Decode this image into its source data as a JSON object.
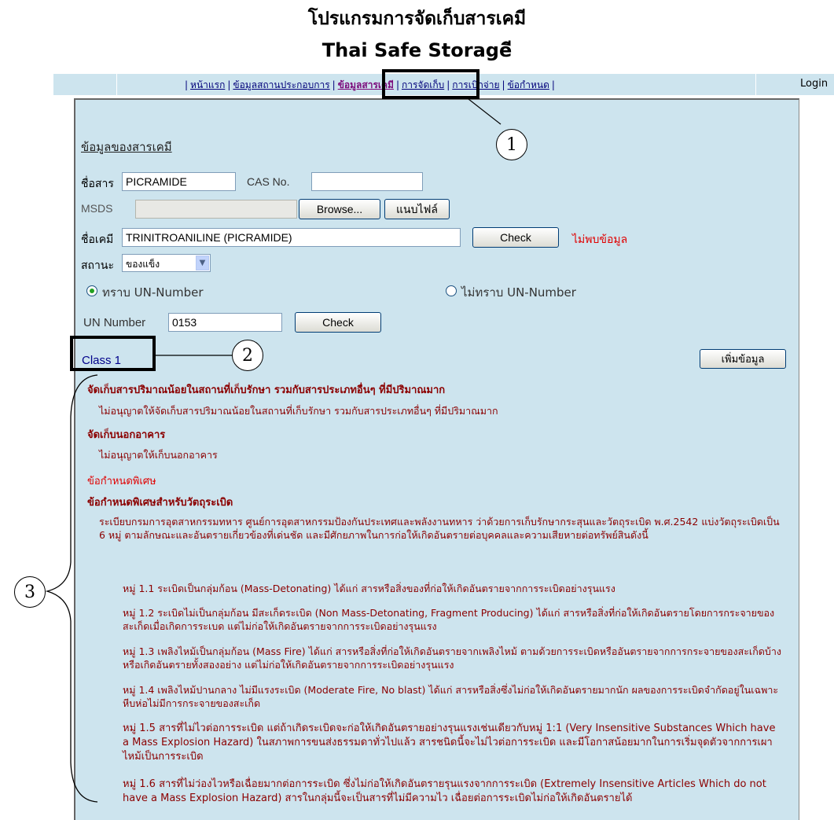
{
  "header": {
    "title_th": "โปรแกรมการจัดเก็บสารเคมี",
    "title_en": "Thai Safe Storageี"
  },
  "nav": {
    "links": [
      "หน้าแรก",
      "ข้อมูลสถานประกอบการ",
      "ข้อมูลสารเคมี",
      "การจัดเก็บ",
      "การเบิกจ่าย",
      "ข้อกำหนด"
    ],
    "active": "ข้อมูลสารเคมี",
    "separator": "|",
    "login": "Login"
  },
  "callouts": [
    "1",
    "2",
    "3"
  ],
  "form": {
    "section_title": "ข้อมูลของสารเคมี",
    "name_label": "ชื่อสาร",
    "name_value": "PICRAMIDE",
    "cas_label": "CAS No.",
    "cas_value": "",
    "msds_label": "MSDS",
    "browse_button": "Browse...",
    "attach_button": "แนบไฟล์",
    "chem_label": "ชื่อเคมี",
    "chem_value": "TRINITROANILINE (PICRAMIDE)",
    "check_button": "Check",
    "not_found": "ไม่พบข้อมูล",
    "state_label": "สถานะ",
    "state_value": "ของแข็ง",
    "radio_known": "ทราบ UN-Number",
    "radio_unknown": "ไม่ทราบ UN-Number",
    "un_label": "UN Number",
    "un_value": "0153",
    "un_check_button": "Check",
    "class_label": "Class 1",
    "add_button": "เพิ่มข้อมูล"
  },
  "details": {
    "h1": "จัดเก็บสารปริมาณน้อยในสถานที่เก็บรักษา รวมกับสารประเภทอื่นๆ ที่มีปริมาณมาก",
    "p1": "ไม่อนุญาตให้จัดเก็บสารปริมาณน้อยในสถานที่เก็บรักษา รวมกับสารประเภทอื่นๆ ที่มีปริมาณมาก",
    "h2": "จัดเก็บนอกอาคาร",
    "p2": "ไม่อนุญาตให้เก็บนอกอาคาร",
    "special": "ข้อกำหนดพิเศษ",
    "h3": "ข้อกำหนดพิเศษสำหรับวัตถุระเบิด",
    "p3": "ระเบียบกรมการอุตสาหกรรมทหาร ศูนย์การอุตสาหกรรมป้องกันประเทศและพลังงานทหาร ว่าด้วยการเก็บรักษากระสุนและวัตถุระเบิด พ.ศ.2542 แบ่งวัตถุระเบิดเป็น 6 หมู่ ตามลักษณะและอันตรายเกี่ยวข้องที่เด่นชัด และมีศักยภาพในการก่อให้เกิดอันตรายต่อบุคคลและความเสียหายต่อทรัพย์สินดังนี้",
    "groups": [
      "หมู่ 1.1 ระเบิดเป็นกลุ่มก้อน (Mass-Detonating) ได้แก่ สารหรือสิ่งของที่ก่อให้เกิดอันตรายจากการระเบิดอย่างรุนแรง",
      "หมู่ 1.2 ระเบิดไม่เป็นกลุ่มก้อน มีสะเก็ดระเบิด (Non Mass-Detonating, Fragment Producing) ได้แก่ สารหรือสิ่งที่ก่อให้เกิดอันตรายโดยการกระจายของสะเก็ดเมื่อเกิดการระเบด แต่ไม่ก่อให้เกิดอันตรายจากการระเบิดอย่างรุนแรง",
      "หมู่ 1.3 เพลิงไหม้เป็นกลุ่มก้อน (Mass Fire) ได้แก่ สารหรือสิ่งที่ก่อให้เกิดอันตรายจากเพลิงไหม้ ตามด้วยการระเบิดหรืออันตรายจากการกระจายของสะเก็ดบ้าง หรือเกิดอันตรายทั้งสองอย่าง แต่ไม่ก่อให้เกิดอันตรายจากการระเบิดอย่างรุนแรง",
      "หมู่ 1.4 เพลิงไหม้ปานกลาง ไม่มีแรงระเบิด (Moderate Fire, No blast) ได้แก่ สารหรือสิ่งซึ่งไม่ก่อให้เกิดอันตรายมากนัก ผลของการระเบิดจำกัดอยู่ในเฉพาะหีบห่อไม่มีการกระจายของสะเก็ด",
      "หมู่ 1.5 สารที่ไม่ไวต่อการระเบิด แต่ถ้าเกิดระเบิดจะก่อให้เกิดอันตรายอย่างรุนแรงเช่นเดียวกับหมู่ 1:1 (Very Insensitive Substances Which have a Mass Explosion Hazard) ในสภาพการขนส่งธรรมดาทั่วไปแล้ว สารชนิดนี้จะไม่ไวต่อการระเบิด และมีโอกาสน้อยมากในการเริ่มจุดตัวจากการเผาไหม้เป็นการระเบิด",
      "หมู่ 1.6 สารที่ไม่ว่องไวหรือเฉื่อยมากต่อการระเบิด ซึ่งไม่ก่อให้เกิดอันตรายรุนแรงจากการระเบิด (Extremely Insensitive Articles Which do not have a Mass Explosion Hazard) สารในกลุ่มนี้จะเป็นสารที่ไม่มีความไว เฉื่อยต่อการระเบิดไม่ก่อให้เกิดอันตรายได้"
    ]
  }
}
